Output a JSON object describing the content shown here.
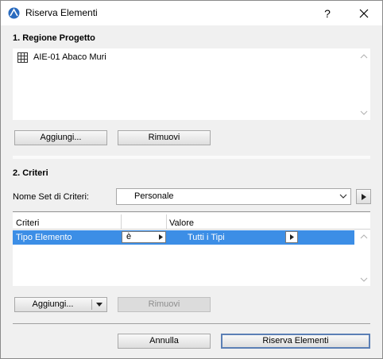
{
  "window": {
    "title": "Riserva Elementi",
    "help_label": "?"
  },
  "section1": {
    "title": "1. Regione Progetto",
    "items": [
      {
        "label": "AIE-01 Abaco Muri",
        "icon": "table-grid-icon"
      }
    ],
    "add_label": "Aggiungi...",
    "remove_label": "Rimuovi"
  },
  "section2": {
    "title": "2. Criteri",
    "criteria_set_label": "Nome Set di Criteri:",
    "criteria_set_value": "Personale",
    "columns": [
      "Criteri",
      "",
      "Valore"
    ],
    "rows": [
      {
        "criterion": "Tipo Elemento",
        "operator": "è",
        "value": "Tutti i Tipi",
        "selected": true
      }
    ],
    "add_label": "Aggiungi...",
    "remove_label": "Rimuovi"
  },
  "footer": {
    "cancel_label": "Annulla",
    "ok_label": "Riserva Elementi"
  },
  "colors": {
    "selection": "#3c8ee6",
    "primary_border": "#5b7fb5"
  }
}
